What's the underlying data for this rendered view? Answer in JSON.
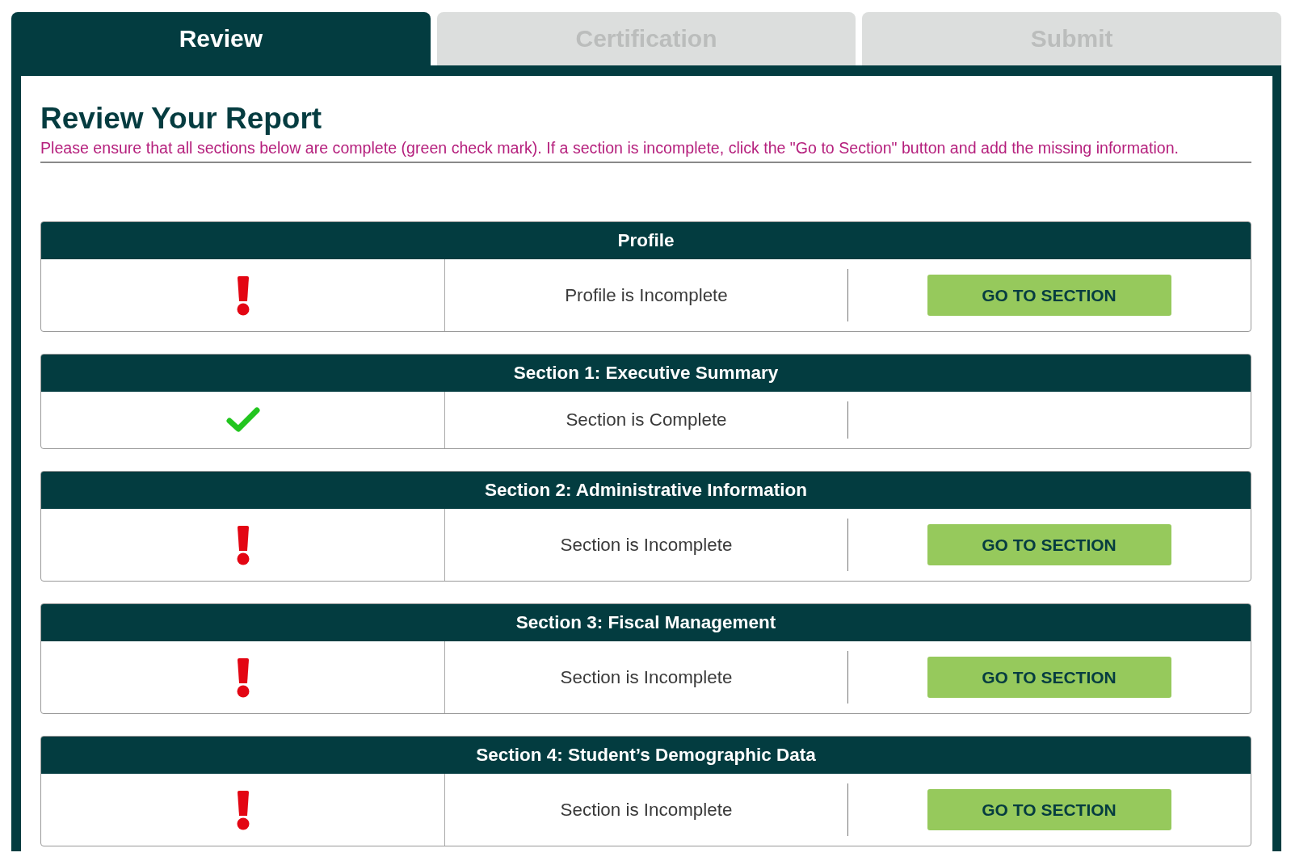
{
  "tabs": [
    {
      "label": "Review",
      "selected": true
    },
    {
      "label": "Certification",
      "selected": false
    },
    {
      "label": "Submit",
      "selected": false
    }
  ],
  "page": {
    "title": "Review Your Report",
    "instructions": "Please ensure that all sections below are complete (green check mark). If a section is incomplete, click the \"Go to Section\" button and add the missing information."
  },
  "sections": [
    {
      "title": "Profile",
      "kind": "incomplete",
      "status_text": "Profile is Incomplete",
      "button": "GO TO SECTION"
    },
    {
      "title": "Section 1: Executive Summary",
      "kind": "complete",
      "status_text": "Section is Complete"
    },
    {
      "title": "Section 2: Administrative Information",
      "kind": "incomplete",
      "status_text": "Section is Incomplete",
      "button": "GO TO SECTION"
    },
    {
      "title": "Section 3: Fiscal Management",
      "kind": "incomplete",
      "status_text": "Section is Incomplete",
      "button": "GO TO SECTION"
    },
    {
      "title": "Section 4: Student’s Demographic Data",
      "kind": "incomplete",
      "status_text": "Section is Incomplete",
      "button": "GO TO SECTION"
    }
  ]
}
